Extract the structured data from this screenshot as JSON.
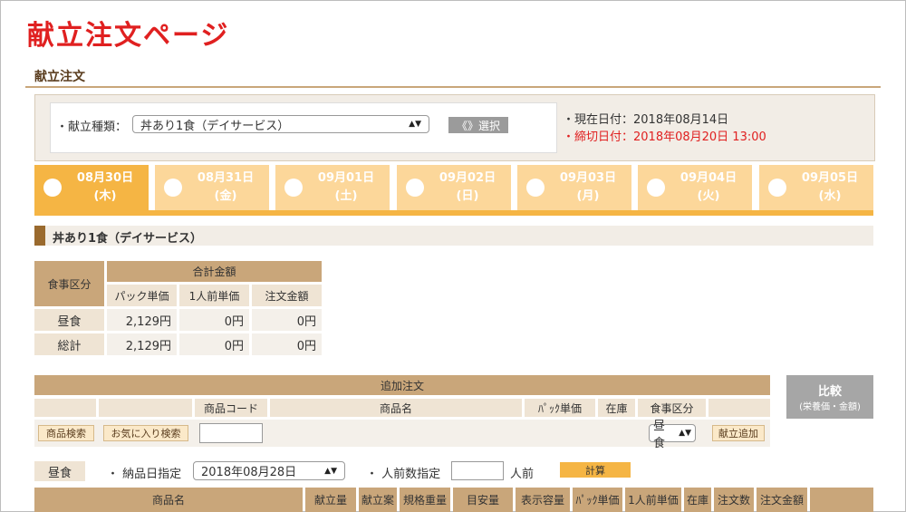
{
  "page": {
    "title": "献立注文ページ",
    "section_title": "献立注文"
  },
  "menu_select": {
    "label": "・献立種類：",
    "value": "丼あり1食（デイサービス）",
    "button": "《》選択",
    "current_date": "・現在日付：2018年08月14日",
    "deadline": "・締切日付：2018年08月20日 13:00"
  },
  "date_tabs": [
    {
      "date": "08月30日",
      "dow": "(木)",
      "active": true
    },
    {
      "date": "08月31日",
      "dow": "(金)",
      "active": false
    },
    {
      "date": "09月01日",
      "dow": "(土)",
      "active": false
    },
    {
      "date": "09月02日",
      "dow": "(日)",
      "active": false
    },
    {
      "date": "09月03日",
      "dow": "(月)",
      "active": false
    },
    {
      "date": "09月04日",
      "dow": "(火)",
      "active": false
    },
    {
      "date": "09月05日",
      "dow": "(水)",
      "active": false
    }
  ],
  "menu_heading": "丼あり1食（デイサービス）",
  "summary": {
    "col_meal": "食事区分",
    "col_total": "合計金額",
    "sub_headers": [
      "パック単価",
      "1人前単価",
      "注文金額"
    ],
    "rows": [
      {
        "label": "昼食",
        "values": [
          "2,129円",
          "0円",
          "0円"
        ]
      },
      {
        "label": "総計",
        "values": [
          "2,129円",
          "0円",
          "0円"
        ]
      }
    ]
  },
  "add_order": {
    "title": "追加注文",
    "headers": [
      "商品コード",
      "商品名",
      "ﾊﾟｯｸ単価",
      "在庫",
      "食事区分"
    ],
    "search_button": "商品検索",
    "favorite_button": "お気に入り検索",
    "meal_select": "昼食",
    "add_button": "献立追加",
    "compare_label": "比較",
    "compare_sub": "(栄養価・金額)"
  },
  "order_controls": {
    "meal_tag": "昼食",
    "delivery_label": "・ 納品日指定",
    "delivery_value": "2018年08月28日",
    "people_label": "・ 人前数指定",
    "people_unit": "人前",
    "calc_button": "計算"
  },
  "items_table": {
    "headers": [
      "商品名",
      "献立量",
      "献立案",
      "規格重量",
      "目安量",
      "表示容量",
      "ﾊﾟｯｸ単価",
      "1人前単価",
      "在庫",
      "注文数",
      "注文金額"
    ]
  }
}
